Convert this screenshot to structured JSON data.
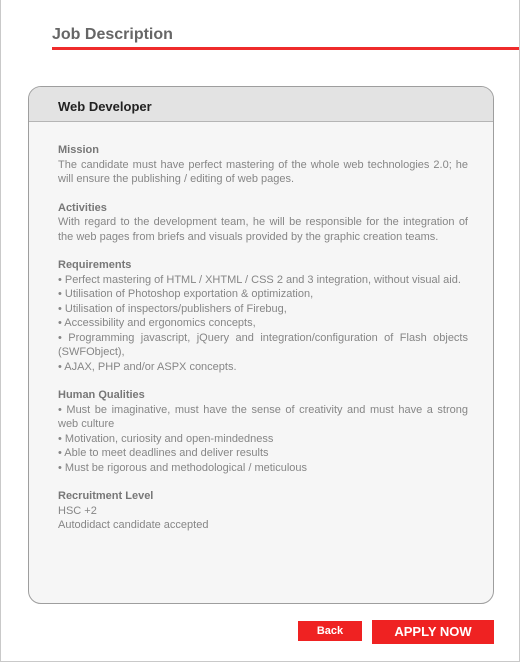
{
  "page": {
    "title": "Job Description"
  },
  "card": {
    "title": "Web Developer",
    "sections": {
      "mission": {
        "heading": "Mission",
        "lines": [
          "The candidate must have perfect mastering of the whole web technologies 2.0; he will ensure the publishing / editing of web pages."
        ]
      },
      "activities": {
        "heading": "Activities",
        "lines": [
          "With regard to the development team, he will be responsible for the integration of the web pages from briefs and visuals provided by the graphic creation teams."
        ]
      },
      "requirements": {
        "heading": "Requirements",
        "lines": [
          "• Perfect mastering of HTML / XHTML / CSS 2 and 3 integration, without visual aid.",
          "• Utilisation of Photoshop exportation & optimization,",
          "• Utilisation of inspectors/publishers of Firebug,",
          "• Accessibility and ergonomics concepts,",
          "• Programming javascript, jQuery and integration/configuration of Flash objects (SWFObject),",
          "• AJAX, PHP and/or ASPX concepts."
        ]
      },
      "human_qualities": {
        "heading": "Human Qualities",
        "lines": [
          "• Must be imaginative, must have the sense of creativity and must have a strong web culture",
          "• Motivation, curiosity and open-mindedness",
          "• Able to meet deadlines and deliver results",
          "• Must be rigorous and methodological / meticulous"
        ]
      },
      "recruitment_level": {
        "heading": "Recruitment Level",
        "lines": [
          "HSC +2",
          "Autodidact candidate accepted"
        ]
      }
    }
  },
  "buttons": {
    "back": "Back",
    "apply": "APPLY NOW"
  },
  "colors": {
    "accent": "#ef2222",
    "card_bg": "#f6f6f6",
    "header_bg": "#e3e3e3"
  }
}
